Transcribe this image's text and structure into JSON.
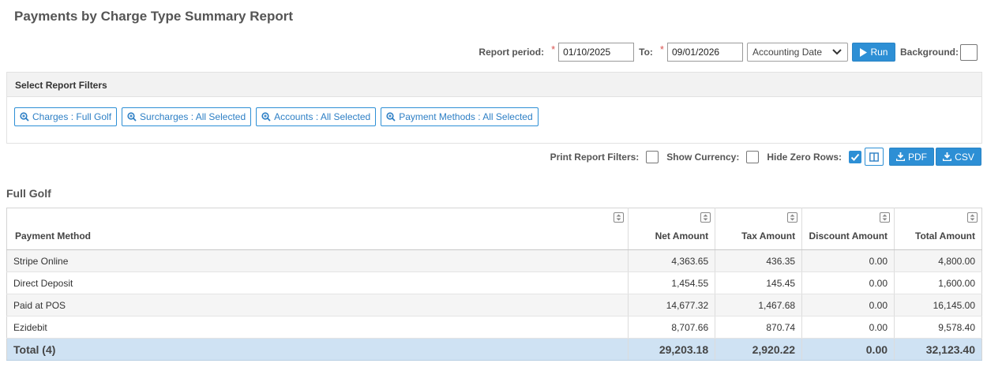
{
  "page": {
    "title": "Payments by Charge Type Summary Report"
  },
  "report_period": {
    "label": "Report period:",
    "from_value": "01/10/2025",
    "to_label": "To:",
    "to_value": "09/01/2026",
    "date_type": "Accounting Date",
    "run_label": "Run",
    "background_label": "Background:"
  },
  "filters": {
    "heading": "Select Report Filters",
    "buttons": [
      "Charges : Full Golf",
      "Surcharges : All Selected",
      "Accounts : All Selected",
      "Payment Methods : All Selected"
    ]
  },
  "options": {
    "print_filters_label": "Print Report Filters:",
    "show_currency_label": "Show Currency:",
    "hide_zero_label": "Hide Zero Rows:",
    "pdf_label": "PDF",
    "csv_label": "CSV",
    "print_filters_checked": false,
    "show_currency_checked": false,
    "hide_zero_checked": true
  },
  "section": {
    "title": "Full Golf"
  },
  "table": {
    "headers": [
      "Payment Method",
      "Net Amount",
      "Tax Amount",
      "Discount Amount",
      "Total Amount"
    ],
    "rows": [
      [
        "Stripe Online",
        "4,363.65",
        "436.35",
        "0.00",
        "4,800.00"
      ],
      [
        "Direct Deposit",
        "1,454.55",
        "145.45",
        "0.00",
        "1,600.00"
      ],
      [
        "Paid at POS",
        "14,677.32",
        "1,467.68",
        "0.00",
        "16,145.00"
      ],
      [
        "Ezidebit",
        "8,707.66",
        "870.74",
        "0.00",
        "9,578.40"
      ]
    ],
    "total": [
      "Total (4)",
      "29,203.18",
      "2,920.22",
      "0.00",
      "32,123.40"
    ]
  },
  "colors": {
    "accent": "#2d8fd5",
    "total_row": "#cfe2f3",
    "required": "#d9534f"
  }
}
